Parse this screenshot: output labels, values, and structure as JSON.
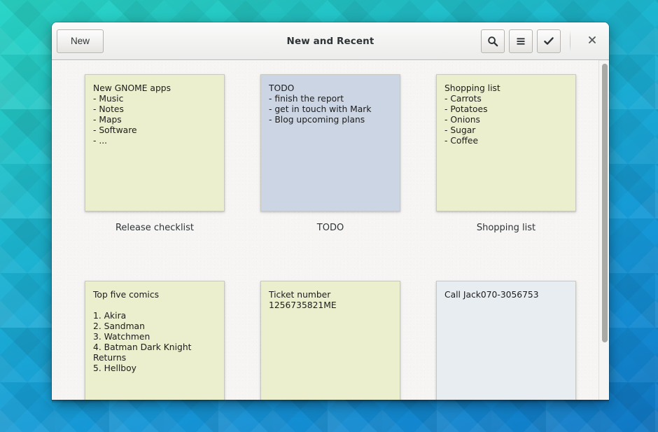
{
  "window": {
    "title": "New and Recent",
    "new_button_label": "New"
  },
  "headerbar": {
    "search_icon": "search-icon",
    "menu_icon": "hamburger-menu-icon",
    "select_icon": "checkmark-icon",
    "close_icon": "close-icon"
  },
  "notes": [
    {
      "label": "Release checklist",
      "body": "New GNOME apps\n- Music\n- Notes\n- Maps\n- Software\n- ...",
      "color": "#ecefcd"
    },
    {
      "label": "TODO",
      "body": "TODO\n- finish the report\n- get in touch with Mark\n- Blog upcoming plans",
      "color": "#ccd5e3"
    },
    {
      "label": "Shopping list",
      "body": "Shopping list\n- Carrots\n- Potatoes\n- Onions\n- Sugar\n- Coffee",
      "color": "#ecefcd"
    },
    {
      "label": "",
      "body": "Top five comics\n\n1. Akira\n2. Sandman\n3. Watchmen\n4. Batman Dark Knight Returns\n5. Hellboy",
      "color": "#ecefcd"
    },
    {
      "label": "",
      "body": "Ticket number\n1256735821ME",
      "color": "#ecefcd"
    },
    {
      "label": "",
      "body": "Call Jack070-3056753",
      "color": "#e8edf2"
    }
  ]
}
